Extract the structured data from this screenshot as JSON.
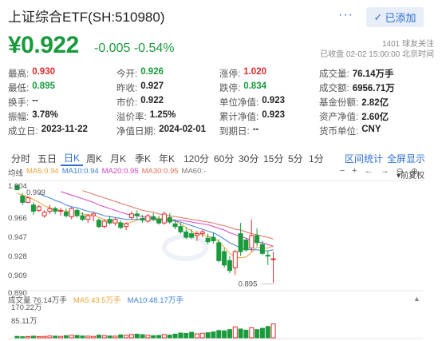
{
  "header": {
    "title": "上证综合ETF(SH:510980)",
    "more_label": "···",
    "add_label": "已添加",
    "price": "¥0.922",
    "change": "-0.005",
    "change_pct": "-0.54%",
    "followers": "1401 球友关注",
    "status": "已收盘 02-02 15:00:00 北京时间"
  },
  "quote": [
    [
      {
        "label": "最高:",
        "value": "0.930",
        "color": "red"
      },
      {
        "label": "今开:",
        "value": "0.926",
        "color": "green"
      },
      {
        "label": "涨停:",
        "value": "1.020",
        "color": "red"
      },
      {
        "label": "成交量:",
        "value": "76.14万手",
        "color": "dark"
      }
    ],
    [
      {
        "label": "最低:",
        "value": "0.895",
        "color": "green"
      },
      {
        "label": "昨收:",
        "value": "0.927",
        "color": "dark"
      },
      {
        "label": "跌停:",
        "value": "0.834",
        "color": "green"
      },
      {
        "label": "成交额:",
        "value": "6956.71万",
        "color": "dark"
      }
    ],
    [
      {
        "label": "换手:",
        "value": "--",
        "color": "dark"
      },
      {
        "label": "市价:",
        "value": "0.922",
        "color": "dark"
      },
      {
        "label": "单位净值:",
        "value": "0.923",
        "color": "dark"
      },
      {
        "label": "基金份额:",
        "value": "2.82亿",
        "color": "dark"
      }
    ],
    [
      {
        "label": "振幅:",
        "value": "3.78%",
        "color": "dark"
      },
      {
        "label": "溢价率:",
        "value": "1.25%",
        "color": "dark"
      },
      {
        "label": "累计净值:",
        "value": "0.923",
        "color": "dark"
      },
      {
        "label": "资产净值:",
        "value": "2.60亿",
        "color": "dark"
      }
    ],
    [
      {
        "label": "成立日:",
        "value": "2023-11-22",
        "color": "dark"
      },
      {
        "label": "净值日期:",
        "value": "2024-02-01",
        "color": "dark"
      },
      {
        "label": "到期日:",
        "value": "--",
        "color": "dark"
      },
      {
        "label": "货币单位:",
        "value": "CNY",
        "color": "dark"
      }
    ]
  ],
  "tabs": [
    "分时",
    "五日",
    "日K",
    "周K",
    "月K",
    "季K",
    "年K",
    "120分",
    "60分",
    "30分",
    "15分",
    "5分",
    "1分"
  ],
  "active_tab": "日K",
  "tab_right": {
    "stats": "区间统计",
    "fullscreen": "全屏显示"
  },
  "legend": [
    {
      "text": "均线",
      "color": "#555555"
    },
    {
      "text": "MA5:0.94",
      "color": "#e9a53a"
    },
    {
      "text": "MA10:0.94",
      "color": "#3f7fd6"
    },
    {
      "text": "MA20:0.95",
      "color": "#d642c4"
    },
    {
      "text": "MA30:0.95",
      "color": "#e2705a"
    },
    {
      "text": "MA60:-",
      "color": "#777777"
    }
  ],
  "controls": [
    "−",
    "+",
    "←",
    "→",
    "⊖",
    "⊕"
  ],
  "fq_label": "前复权",
  "y_labels": [
    "1.004",
    "0.999",
    "0.966",
    "0.947",
    "0.928",
    "0.909",
    "0.890"
  ],
  "low_marker": "0.895",
  "volume": {
    "label": "成交量 76.14万手",
    "ma5": "MA5:43.5万手",
    "ma10": "MA10:48.17万手",
    "max": "170.22万",
    "mid": "85.11万"
  },
  "colors": {
    "up": "#e02b2b",
    "down": "#1a9a3d",
    "accent": "#2f6fd0"
  },
  "chart_data": {
    "type": "candlestick",
    "ylim": [
      0.89,
      1.004
    ],
    "candles": [
      [
        1.004,
        1.004,
        0.999,
        0.999
      ],
      [
        0.992,
        0.995,
        0.982,
        0.985
      ],
      [
        0.985,
        0.992,
        0.984,
        0.99
      ],
      [
        0.982,
        0.985,
        0.971,
        0.975
      ],
      [
        0.976,
        0.982,
        0.974,
        0.98
      ],
      [
        0.97,
        0.976,
        0.968,
        0.974
      ],
      [
        0.975,
        0.982,
        0.972,
        0.978
      ],
      [
        0.978,
        0.98,
        0.972,
        0.975
      ],
      [
        0.975,
        0.979,
        0.97,
        0.976
      ],
      [
        0.974,
        0.978,
        0.968,
        0.97
      ],
      [
        0.969,
        0.98,
        0.966,
        0.978
      ],
      [
        0.976,
        0.978,
        0.968,
        0.97
      ],
      [
        0.97,
        0.974,
        0.964,
        0.966
      ],
      [
        0.966,
        0.972,
        0.962,
        0.97
      ],
      [
        0.97,
        0.974,
        0.964,
        0.972
      ],
      [
        0.965,
        0.967,
        0.956,
        0.958
      ],
      [
        0.958,
        0.966,
        0.956,
        0.964
      ],
      [
        0.966,
        0.97,
        0.96,
        0.962
      ],
      [
        0.962,
        0.968,
        0.959,
        0.966
      ],
      [
        0.962,
        0.965,
        0.955,
        0.957
      ],
      [
        0.958,
        0.963,
        0.954,
        0.961
      ],
      [
        0.968,
        0.975,
        0.966,
        0.972
      ],
      [
        0.972,
        0.976,
        0.966,
        0.97
      ],
      [
        0.967,
        0.971,
        0.962,
        0.965
      ],
      [
        0.964,
        0.972,
        0.962,
        0.97
      ],
      [
        0.969,
        0.973,
        0.964,
        0.966
      ],
      [
        0.966,
        0.97,
        0.96,
        0.962
      ],
      [
        0.962,
        0.975,
        0.96,
        0.972
      ],
      [
        0.968,
        0.973,
        0.961,
        0.963
      ],
      [
        0.961,
        0.966,
        0.955,
        0.958
      ],
      [
        0.958,
        0.962,
        0.95,
        0.952
      ],
      [
        0.952,
        0.957,
        0.944,
        0.946
      ],
      [
        0.95,
        0.955,
        0.944,
        0.946
      ],
      [
        0.948,
        0.953,
        0.942,
        0.95
      ],
      [
        0.95,
        0.954,
        0.946,
        0.952
      ],
      [
        0.945,
        0.95,
        0.938,
        0.941
      ],
      [
        0.946,
        0.951,
        0.939,
        0.942
      ],
      [
        0.94,
        0.944,
        0.918,
        0.92
      ],
      [
        0.93,
        0.934,
        0.912,
        0.915
      ],
      [
        0.92,
        0.925,
        0.906,
        0.909
      ],
      [
        0.912,
        0.932,
        0.904,
        0.93
      ],
      [
        0.95,
        0.962,
        0.925,
        0.93
      ],
      [
        0.943,
        0.945,
        0.93,
        0.932
      ],
      [
        0.934,
        0.966,
        0.93,
        0.948
      ],
      [
        0.948,
        0.956,
        0.936,
        0.94
      ],
      [
        0.938,
        0.942,
        0.926,
        0.928
      ],
      [
        0.926,
        0.931,
        0.915,
        0.925
      ],
      [
        0.922,
        0.93,
        0.895,
        0.922
      ]
    ],
    "ma5": [
      0.995,
      0.993,
      0.991,
      0.988,
      0.985,
      0.981,
      0.979,
      0.977,
      0.976,
      0.975,
      0.975,
      0.974,
      0.972,
      0.971,
      0.971,
      0.968,
      0.966,
      0.965,
      0.964,
      0.962,
      0.961,
      0.963,
      0.965,
      0.967,
      0.968,
      0.968,
      0.967,
      0.967,
      0.966,
      0.964,
      0.961,
      0.957,
      0.953,
      0.95,
      0.949,
      0.947,
      0.946,
      0.941,
      0.935,
      0.928,
      0.924,
      0.923,
      0.924,
      0.929,
      0.935,
      0.934,
      0.934,
      0.936
    ],
    "ma10": [
      null,
      null,
      null,
      null,
      0.995,
      0.992,
      0.99,
      0.987,
      0.985,
      0.982,
      0.98,
      0.979,
      0.977,
      0.975,
      0.974,
      0.972,
      0.97,
      0.969,
      0.968,
      0.967,
      0.966,
      0.966,
      0.966,
      0.966,
      0.966,
      0.966,
      0.965,
      0.965,
      0.965,
      0.964,
      0.963,
      0.961,
      0.959,
      0.957,
      0.955,
      0.953,
      0.951,
      0.948,
      0.944,
      0.94,
      0.937,
      0.934,
      0.933,
      0.932,
      0.932,
      0.931,
      0.931,
      0.932
    ],
    "ma20": [
      null,
      null,
      null,
      null,
      null,
      null,
      null,
      null,
      0.997,
      0.995,
      0.993,
      0.991,
      0.989,
      0.987,
      0.985,
      0.982,
      0.98,
      0.978,
      0.976,
      0.974,
      0.972,
      0.971,
      0.97,
      0.969,
      0.968,
      0.967,
      0.966,
      0.966,
      0.966,
      0.965,
      0.965,
      0.964,
      0.963,
      0.962,
      0.961,
      0.96,
      0.958,
      0.956,
      0.954,
      0.951,
      0.949,
      0.947,
      0.945,
      0.943,
      0.941,
      0.94,
      0.938,
      0.936
    ],
    "ma30": [
      null,
      null,
      null,
      null,
      null,
      null,
      null,
      null,
      null,
      null,
      null,
      null,
      0.998,
      0.996,
      0.994,
      0.992,
      0.99,
      0.988,
      0.986,
      0.984,
      0.982,
      0.98,
      0.978,
      0.976,
      0.975,
      0.974,
      0.972,
      0.971,
      0.97,
      0.969,
      0.968,
      0.967,
      0.966,
      0.965,
      0.964,
      0.963,
      0.962,
      0.96,
      0.959,
      0.957,
      0.955,
      0.954,
      0.952,
      0.95,
      0.949,
      0.947,
      0.946,
      0.944
    ],
    "volumes": [
      8,
      6,
      7,
      9,
      7,
      8,
      10,
      9,
      8,
      12,
      14,
      13,
      10,
      9,
      8,
      15,
      12,
      10,
      9,
      16,
      14,
      18,
      20,
      17,
      14,
      12,
      13,
      18,
      15,
      20,
      26,
      24,
      30,
      22,
      25,
      28,
      32,
      40,
      38,
      45,
      60,
      48,
      42,
      55,
      45,
      52,
      62,
      76
    ]
  }
}
